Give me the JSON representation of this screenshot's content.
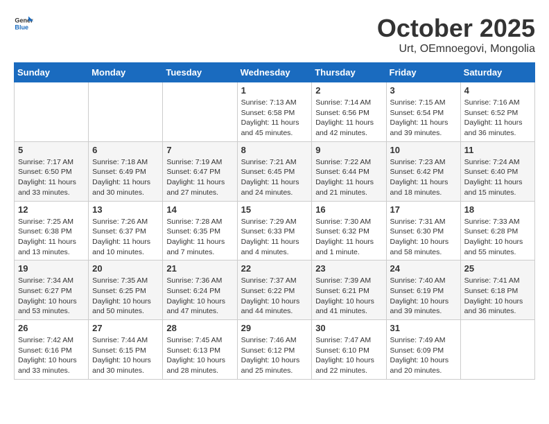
{
  "header": {
    "logo_general": "General",
    "logo_blue": "Blue",
    "month_title": "October 2025",
    "subtitle": "Urt, OEmnoegovi, Mongolia"
  },
  "weekdays": [
    "Sunday",
    "Monday",
    "Tuesday",
    "Wednesday",
    "Thursday",
    "Friday",
    "Saturday"
  ],
  "weeks": [
    [
      {
        "day": "",
        "info": ""
      },
      {
        "day": "",
        "info": ""
      },
      {
        "day": "",
        "info": ""
      },
      {
        "day": "1",
        "info": "Sunrise: 7:13 AM\nSunset: 6:58 PM\nDaylight: 11 hours and 45 minutes."
      },
      {
        "day": "2",
        "info": "Sunrise: 7:14 AM\nSunset: 6:56 PM\nDaylight: 11 hours and 42 minutes."
      },
      {
        "day": "3",
        "info": "Sunrise: 7:15 AM\nSunset: 6:54 PM\nDaylight: 11 hours and 39 minutes."
      },
      {
        "day": "4",
        "info": "Sunrise: 7:16 AM\nSunset: 6:52 PM\nDaylight: 11 hours and 36 minutes."
      }
    ],
    [
      {
        "day": "5",
        "info": "Sunrise: 7:17 AM\nSunset: 6:50 PM\nDaylight: 11 hours and 33 minutes."
      },
      {
        "day": "6",
        "info": "Sunrise: 7:18 AM\nSunset: 6:49 PM\nDaylight: 11 hours and 30 minutes."
      },
      {
        "day": "7",
        "info": "Sunrise: 7:19 AM\nSunset: 6:47 PM\nDaylight: 11 hours and 27 minutes."
      },
      {
        "day": "8",
        "info": "Sunrise: 7:21 AM\nSunset: 6:45 PM\nDaylight: 11 hours and 24 minutes."
      },
      {
        "day": "9",
        "info": "Sunrise: 7:22 AM\nSunset: 6:44 PM\nDaylight: 11 hours and 21 minutes."
      },
      {
        "day": "10",
        "info": "Sunrise: 7:23 AM\nSunset: 6:42 PM\nDaylight: 11 hours and 18 minutes."
      },
      {
        "day": "11",
        "info": "Sunrise: 7:24 AM\nSunset: 6:40 PM\nDaylight: 11 hours and 15 minutes."
      }
    ],
    [
      {
        "day": "12",
        "info": "Sunrise: 7:25 AM\nSunset: 6:38 PM\nDaylight: 11 hours and 13 minutes."
      },
      {
        "day": "13",
        "info": "Sunrise: 7:26 AM\nSunset: 6:37 PM\nDaylight: 11 hours and 10 minutes."
      },
      {
        "day": "14",
        "info": "Sunrise: 7:28 AM\nSunset: 6:35 PM\nDaylight: 11 hours and 7 minutes."
      },
      {
        "day": "15",
        "info": "Sunrise: 7:29 AM\nSunset: 6:33 PM\nDaylight: 11 hours and 4 minutes."
      },
      {
        "day": "16",
        "info": "Sunrise: 7:30 AM\nSunset: 6:32 PM\nDaylight: 11 hours and 1 minute."
      },
      {
        "day": "17",
        "info": "Sunrise: 7:31 AM\nSunset: 6:30 PM\nDaylight: 10 hours and 58 minutes."
      },
      {
        "day": "18",
        "info": "Sunrise: 7:33 AM\nSunset: 6:28 PM\nDaylight: 10 hours and 55 minutes."
      }
    ],
    [
      {
        "day": "19",
        "info": "Sunrise: 7:34 AM\nSunset: 6:27 PM\nDaylight: 10 hours and 53 minutes."
      },
      {
        "day": "20",
        "info": "Sunrise: 7:35 AM\nSunset: 6:25 PM\nDaylight: 10 hours and 50 minutes."
      },
      {
        "day": "21",
        "info": "Sunrise: 7:36 AM\nSunset: 6:24 PM\nDaylight: 10 hours and 47 minutes."
      },
      {
        "day": "22",
        "info": "Sunrise: 7:37 AM\nSunset: 6:22 PM\nDaylight: 10 hours and 44 minutes."
      },
      {
        "day": "23",
        "info": "Sunrise: 7:39 AM\nSunset: 6:21 PM\nDaylight: 10 hours and 41 minutes."
      },
      {
        "day": "24",
        "info": "Sunrise: 7:40 AM\nSunset: 6:19 PM\nDaylight: 10 hours and 39 minutes."
      },
      {
        "day": "25",
        "info": "Sunrise: 7:41 AM\nSunset: 6:18 PM\nDaylight: 10 hours and 36 minutes."
      }
    ],
    [
      {
        "day": "26",
        "info": "Sunrise: 7:42 AM\nSunset: 6:16 PM\nDaylight: 10 hours and 33 minutes."
      },
      {
        "day": "27",
        "info": "Sunrise: 7:44 AM\nSunset: 6:15 PM\nDaylight: 10 hours and 30 minutes."
      },
      {
        "day": "28",
        "info": "Sunrise: 7:45 AM\nSunset: 6:13 PM\nDaylight: 10 hours and 28 minutes."
      },
      {
        "day": "29",
        "info": "Sunrise: 7:46 AM\nSunset: 6:12 PM\nDaylight: 10 hours and 25 minutes."
      },
      {
        "day": "30",
        "info": "Sunrise: 7:47 AM\nSunset: 6:10 PM\nDaylight: 10 hours and 22 minutes."
      },
      {
        "day": "31",
        "info": "Sunrise: 7:49 AM\nSunset: 6:09 PM\nDaylight: 10 hours and 20 minutes."
      },
      {
        "day": "",
        "info": ""
      }
    ]
  ]
}
